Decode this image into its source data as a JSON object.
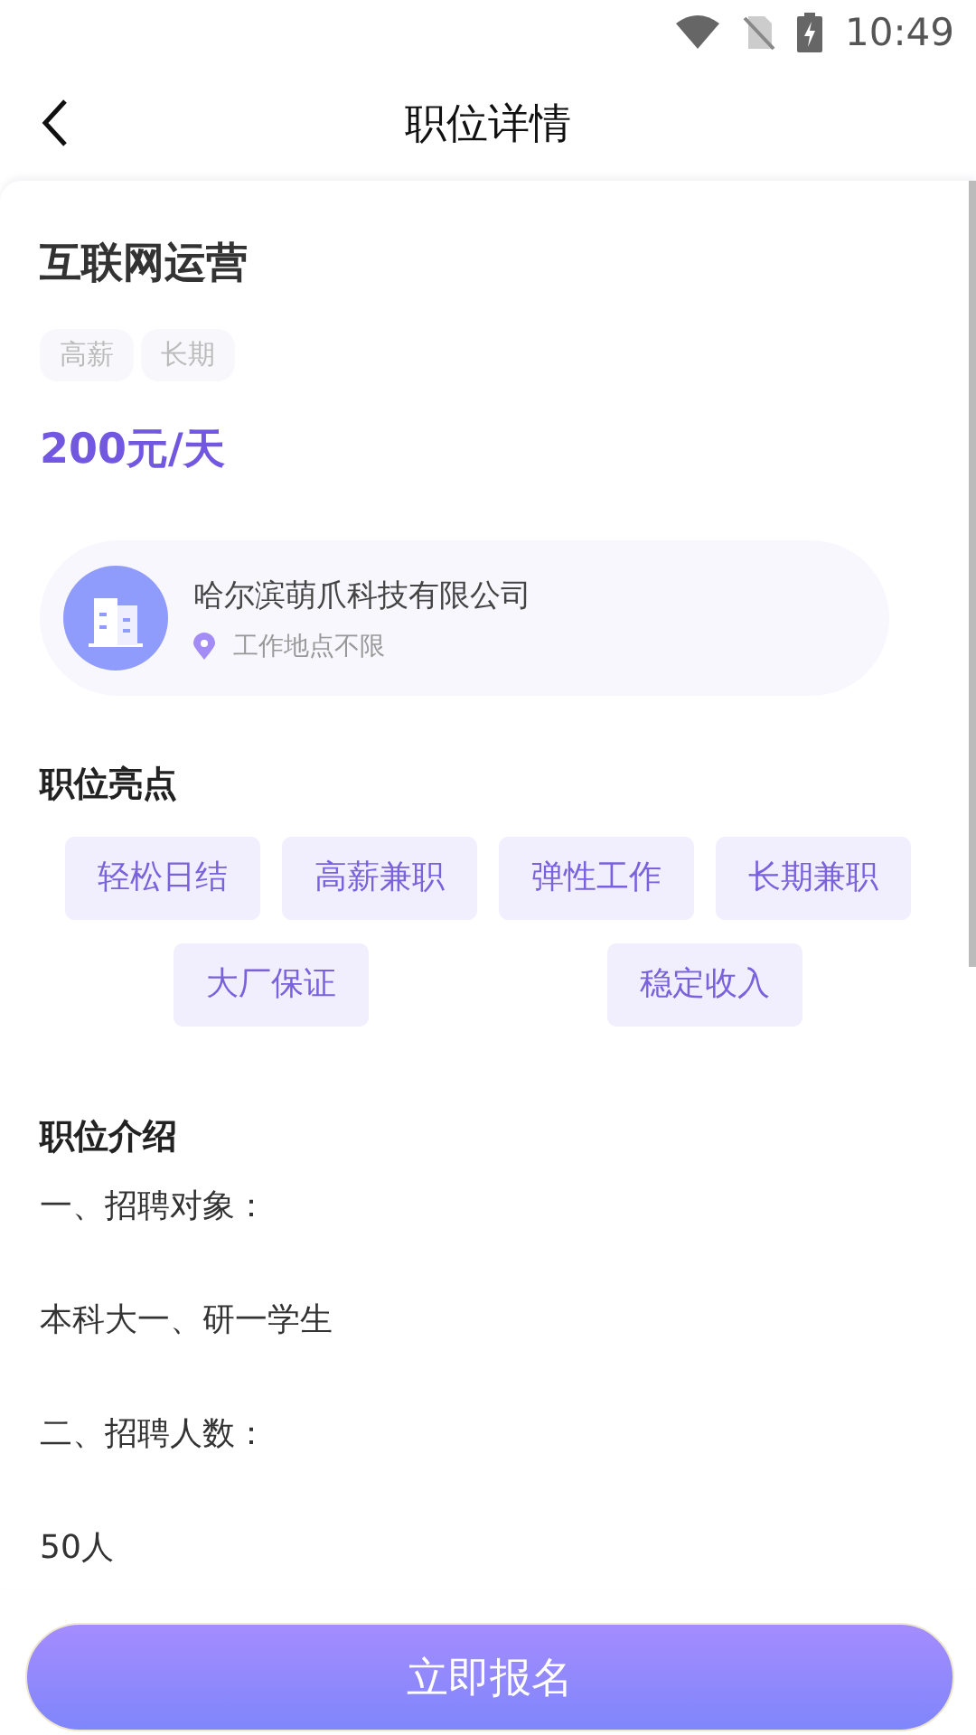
{
  "status_bar": {
    "time": "10:49"
  },
  "header": {
    "title": "职位详情"
  },
  "job": {
    "title": "互联网运营",
    "tags": [
      "高薪",
      "长期"
    ],
    "salary": "200元/天"
  },
  "company": {
    "name": "哈尔滨萌爪科技有限公司",
    "location": "工作地点不限"
  },
  "highlights": {
    "heading": "职位亮点",
    "items": [
      "轻松日结",
      "高薪兼职",
      "弹性工作",
      "长期兼职",
      "大厂保证",
      "稳定收入"
    ]
  },
  "intro": {
    "heading": "职位介绍",
    "lines": [
      "一、招聘对象：",
      "本科大一、研一学生",
      "二、招聘人数：",
      "50人"
    ]
  },
  "apply_button": {
    "label": "立即报名"
  }
}
